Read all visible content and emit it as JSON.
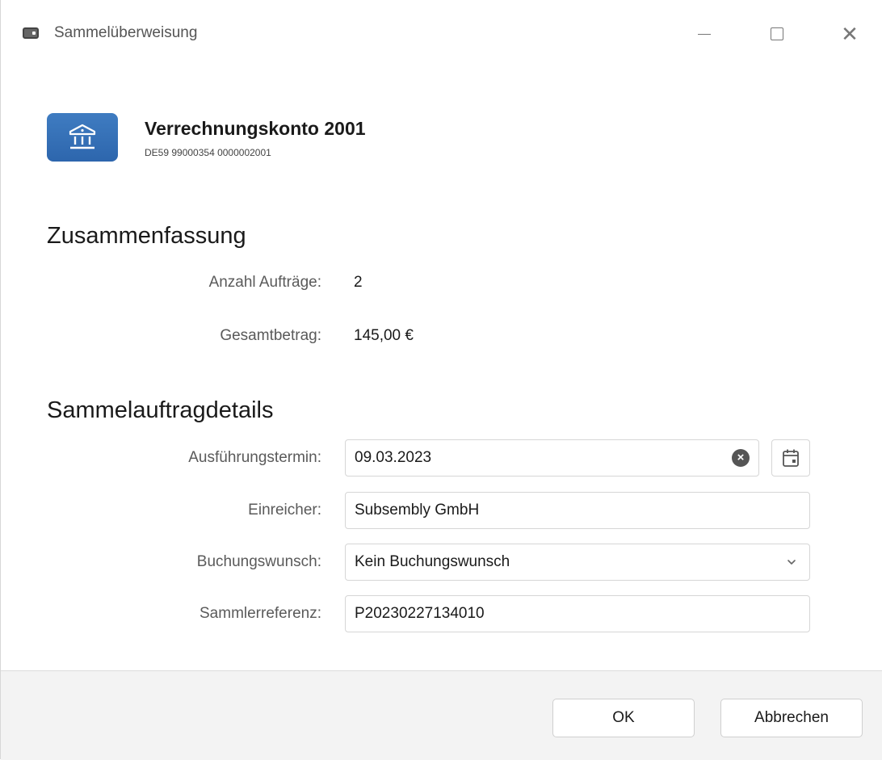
{
  "window": {
    "title": "Sammelüberweisung"
  },
  "account": {
    "name": "Verrechnungskonto 2001",
    "iban": "DE59 99000354 0000002001"
  },
  "summary": {
    "title": "Zusammenfassung",
    "count_label": "Anzahl Aufträge:",
    "count_value": "2",
    "total_label": "Gesamtbetrag:",
    "total_value": "145,00 €"
  },
  "details": {
    "title": "Sammelauftragdetails",
    "date_label": "Ausführungstermin:",
    "date_value": "09.03.2023",
    "submitter_label": "Einreicher:",
    "submitter_value": "Subsembly GmbH",
    "booking_label": "Buchungswunsch:",
    "booking_value": "Kein Buchungswunsch",
    "reference_label": "Sammlerreferenz:",
    "reference_value": "P20230227134010"
  },
  "buttons": {
    "ok": "OK",
    "cancel": "Abbrechen"
  },
  "colors": {
    "bank_tile": "#3574b8"
  }
}
